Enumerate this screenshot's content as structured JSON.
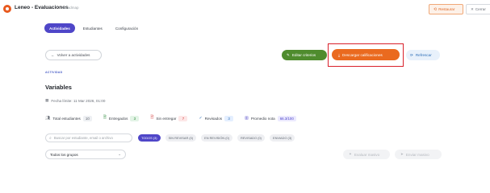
{
  "window": {
    "title": "Leneo - Evaluaciones",
    "subtitle": "Roadmap",
    "restore_label": "Restaurar",
    "close_label": "Cerrar"
  },
  "tabs": [
    {
      "label": "Actividades",
      "active": true
    },
    {
      "label": "Estudiantes",
      "active": false
    },
    {
      "label": "Configuración",
      "active": false
    }
  ],
  "toolbar": {
    "back_label": "Volver a actividades",
    "edit_label": "Editar criterios",
    "download_label": "Descargar calificaciones",
    "refresh_label": "Refrescar"
  },
  "activity": {
    "section_label": "ACTIVIDAD",
    "title": "Variables",
    "date_text": "Fecha límite: 11 Mar 2026, 01:00"
  },
  "stats": [
    {
      "icon": "users-icon",
      "label": "Total estudiantes",
      "value": "10",
      "bg": "#eef0f3",
      "color": "#5f6670"
    },
    {
      "icon": "doc-check-icon",
      "label": "Entregados",
      "value": "3",
      "bg": "#e3f4e6",
      "color": "#2f8a3e"
    },
    {
      "icon": "doc-x-icon",
      "label": "Sin entregar",
      "value": "7",
      "bg": "#fde7e7",
      "color": "#d23b3b"
    },
    {
      "icon": "check-icon",
      "label": "Revisados",
      "value": "3",
      "bg": "#e4efff",
      "color": "#2e6fb8"
    },
    {
      "icon": "bar-chart-icon",
      "label": "Promedio nota",
      "value": "66.3/100",
      "bg": "#eceaff",
      "color": "#4f46c8"
    }
  ],
  "search": {
    "placeholder": "Buscar por estudiante, email o archivo"
  },
  "filters": [
    {
      "label": "TODOS (3)",
      "active": true
    },
    {
      "label": "SIN REVISAR (0)",
      "active": false
    },
    {
      "label": "EN REVISIÓN (0)",
      "active": false
    },
    {
      "label": "REVISADO (0)",
      "active": false
    },
    {
      "label": "ENVIADO (3)",
      "active": false
    }
  ],
  "group_select": {
    "value": "Todos los grupos"
  },
  "actions": {
    "grade_label": "Evaluar masivo",
    "send_label": "Enviar masivo"
  },
  "colors": {
    "accent": "#4f46c8",
    "download": "#ea6a1f",
    "edit": "#4f8c2e",
    "highlight": "#d9202a"
  }
}
